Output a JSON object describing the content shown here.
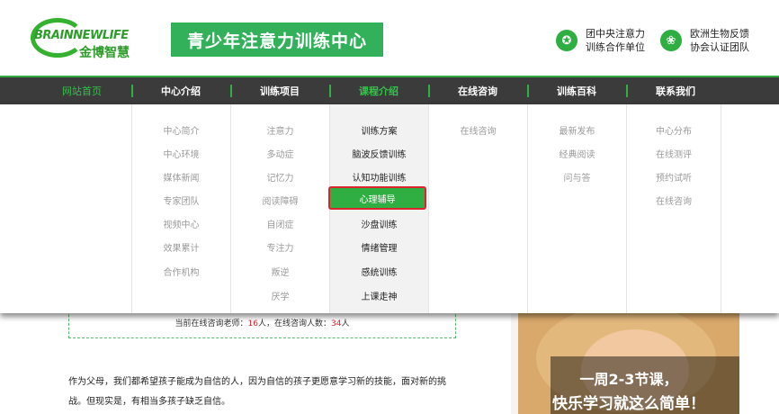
{
  "header": {
    "logo_en": "BRAINNEWLIFE",
    "logo_cn": "金博智慧",
    "site_title": "青少年注意力训练中心",
    "badges": [
      {
        "icon": "award-icon",
        "line1": "团中央注意力",
        "line2": "训练合作单位"
      },
      {
        "icon": "flower-icon",
        "line1": "欧洲生物反馈",
        "line2": "协会认证团队"
      }
    ]
  },
  "nav": {
    "items": [
      "网站首页",
      "中心介绍",
      "训练项目",
      "课程介绍",
      "在线咨询",
      "训练百科",
      "联系我们"
    ],
    "active_index": 0,
    "hover_index": 3
  },
  "dropdown": {
    "columns": [
      {
        "items": [
          "中心简介",
          "中心环境",
          "媒体新闻",
          "专家团队",
          "视频中心",
          "效果累计",
          "合作机构"
        ]
      },
      {
        "items": [
          "注意力",
          "多动症",
          "记忆力",
          "阅读障碍",
          "自闭症",
          "专注力",
          "叛逆",
          "厌学"
        ]
      },
      {
        "items": [
          "训练方案",
          "脑波反馈训练",
          "认知功能训练",
          "心理辅导",
          "沙盘训练",
          "情绪管理",
          "感统训练",
          "上课走神"
        ],
        "selected_item": 3
      },
      {
        "items": [
          "在线咨询"
        ]
      },
      {
        "items": [
          "最新发布",
          "经典阅读",
          "问与答"
        ]
      },
      {
        "items": [
          "中心分布",
          "在线测评",
          "预约试听",
          "在线咨询"
        ]
      }
    ]
  },
  "consult": {
    "prefix": "当前在线咨询老师：",
    "teachers": "16",
    "mid": "人，在线咨询人数：",
    "users": "34",
    "suffix": "人"
  },
  "article": {
    "paragraph": "作为父母，我们都希望孩子能成为自信的人，因为自信的孩子更愿意学习新的技能，面对新的挑战。但现实是，有相当多孩子缺乏自信。"
  },
  "promo": {
    "line1": "一周2-3节课，",
    "line2": "快乐学习就这么简单！"
  },
  "colors": {
    "brand_green": "#2fae42",
    "nav_bg": "#3b3b3b",
    "highlight_border": "#d9262c",
    "number_red": "#e3232c"
  }
}
